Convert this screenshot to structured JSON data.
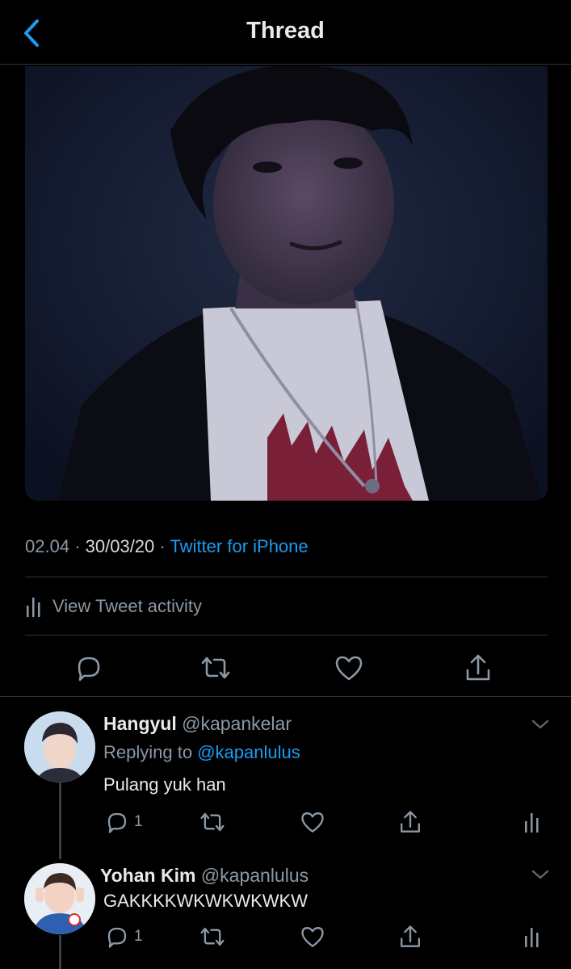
{
  "header": {
    "title": "Thread",
    "back_icon": "chevron-left-icon"
  },
  "tweet": {
    "time": "02.04",
    "sep1": "·",
    "date": "30/03/20",
    "sep2": "·",
    "source": "Twitter for iPhone",
    "activity_label": "View Tweet activity",
    "actions": [
      "reply-icon",
      "retweet-icon",
      "like-icon",
      "share-icon"
    ]
  },
  "replies": [
    {
      "name": "Hangyul",
      "handle": "@kapankelar",
      "replying_prefix": "Replying to",
      "replying_to": "@kapanlulus",
      "text": "Pulang yuk han",
      "reply_count": "1"
    },
    {
      "name": "Yohan Kim",
      "handle": "@kapanlulus",
      "text": "GAKKKKWKWKWKWKW",
      "reply_count": "1"
    }
  ],
  "colors": {
    "accent": "#1d9bf0",
    "background": "#000000",
    "muted": "#8b98a5",
    "divider": "#2f3336"
  }
}
